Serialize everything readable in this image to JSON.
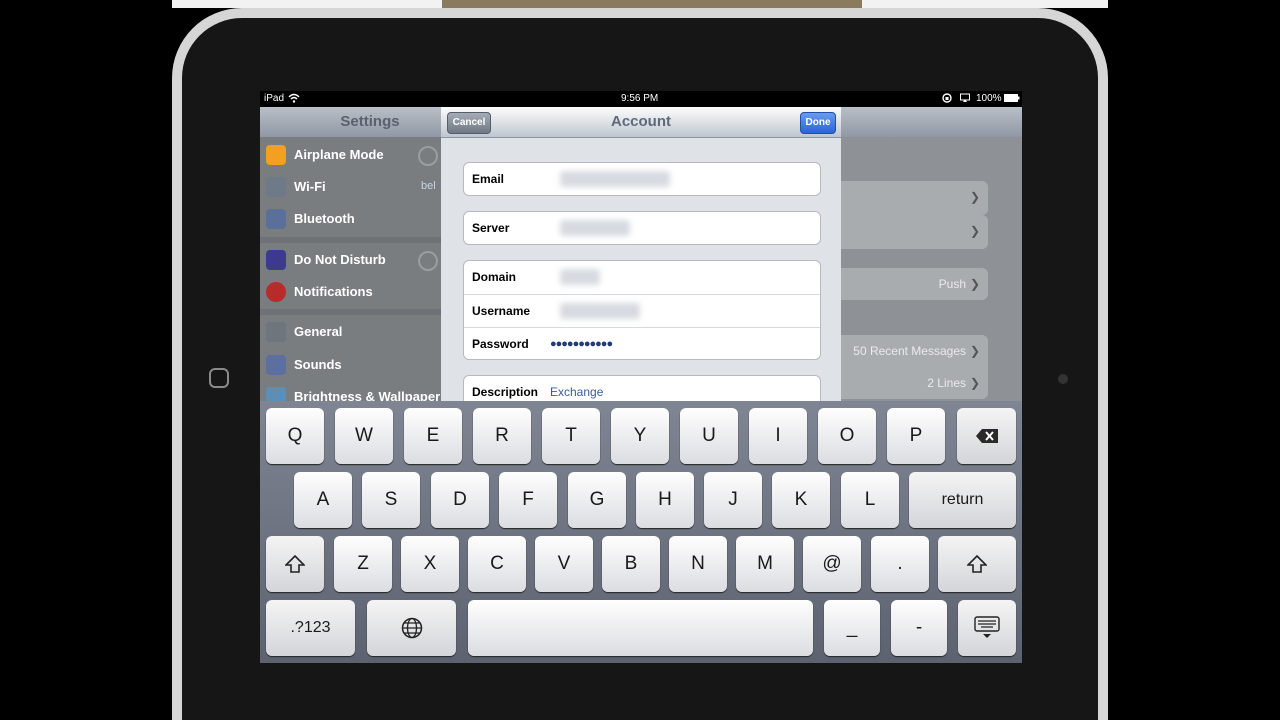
{
  "status_bar": {
    "device": "iPad",
    "time": "9:56 PM",
    "battery": "100%"
  },
  "settings": {
    "title": "Settings",
    "items": [
      {
        "label": "Airplane Mode",
        "icon": "airplane-icon",
        "color": "#f2a020"
      },
      {
        "label": "Wi-Fi",
        "icon": "wifi-icon",
        "color": "#4a6fd8",
        "value": "bel"
      },
      {
        "label": "Bluetooth",
        "icon": "bluetooth-icon",
        "color": "#3b5fc5"
      },
      {
        "label": "Do Not Disturb",
        "icon": "moon-icon",
        "color": "#4d4ab8"
      },
      {
        "label": "Notifications",
        "icon": "notifications-icon",
        "color": "#d23030"
      },
      {
        "label": "General",
        "icon": "gear-icon",
        "color": "#8a8f96"
      },
      {
        "label": "Sounds",
        "icon": "speaker-icon",
        "color": "#d23060"
      },
      {
        "label": "Brightness & Wallpaper",
        "icon": "brightness-icon",
        "color": "#3aa0e0"
      }
    ]
  },
  "detail": {
    "rows": [
      "Push",
      "50 Recent Messages",
      "2 Lines"
    ]
  },
  "account": {
    "title": "Account",
    "cancel_label": "Cancel",
    "done_label": "Done",
    "email_label": "Email",
    "server_label": "Server",
    "domain_label": "Domain",
    "username_label": "Username",
    "password_label": "Password",
    "password_value": "●●●●●●●●●●●",
    "description_label": "Description",
    "description_value": "Exchange"
  },
  "keyboard": {
    "row1": [
      "Q",
      "W",
      "E",
      "R",
      "T",
      "Y",
      "U",
      "I",
      "O",
      "P"
    ],
    "row2": [
      "A",
      "S",
      "D",
      "F",
      "G",
      "H",
      "J",
      "K",
      "L"
    ],
    "return_label": "return",
    "row3": [
      "Z",
      "X",
      "C",
      "V",
      "B",
      "N",
      "M",
      "@",
      "."
    ],
    "numbers_label": ".?123",
    "underscore_label": "_",
    "dash_label": "-"
  }
}
